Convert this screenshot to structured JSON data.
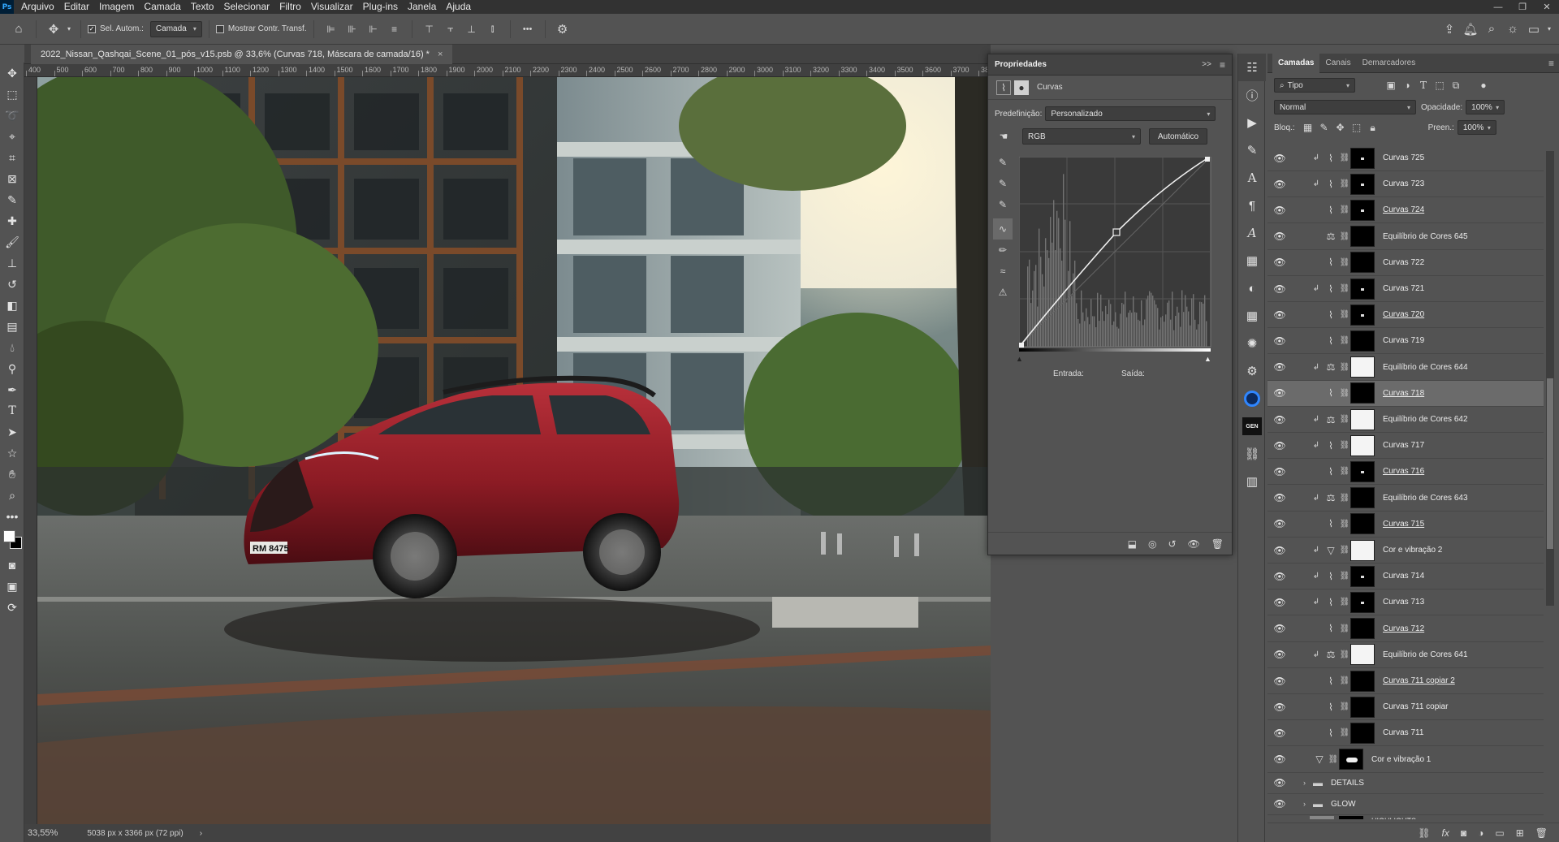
{
  "menubar": {
    "logo": "Ps",
    "items": [
      "Arquivo",
      "Editar",
      "Imagem",
      "Camada",
      "Texto",
      "Selecionar",
      "Filtro",
      "Visualizar",
      "Plug-ins",
      "Janela",
      "Ajuda"
    ],
    "win_min": "—",
    "win_max": "❐",
    "win_close": "✕"
  },
  "options": {
    "auto_select_label": "Sel. Autom.:",
    "auto_select_target": "Camada",
    "show_transform_label": "Mostrar Contr. Transf.",
    "more": "•••"
  },
  "document": {
    "tab_title": "2022_Nissan_Qashqai_Scene_01_pós_v15.psb @ 33,6% (Curvas 718, Máscara de camada/16) *",
    "tab_close": "×",
    "ruler_labels": [
      "400",
      "500",
      "600",
      "700",
      "800",
      "900",
      "1000",
      "1100",
      "1200",
      "1300",
      "1400",
      "1500",
      "1600",
      "1700",
      "1800",
      "1900",
      "2000",
      "2100",
      "2200",
      "2300",
      "2400",
      "2500",
      "2600",
      "2700",
      "2800",
      "2900",
      "3000",
      "3100",
      "3200",
      "3300",
      "3400",
      "3500",
      "3600",
      "3700",
      "38"
    ],
    "license_plate": "RM 8475",
    "zoom": "33,55%",
    "doc_size": "5038 px x 3366 px (72 ppi)",
    "status_arrow": "›"
  },
  "properties": {
    "title": "Propriedades",
    "collapse": ">>",
    "menu": "≡",
    "adjustment_label": "Curvas",
    "preset_label": "Predefinição:",
    "preset_value": "Personalizado",
    "channel_value": "RGB",
    "auto_button": "Automático",
    "input_label": "Entrada:",
    "output_label": "Saída:"
  },
  "layers": {
    "tabs": [
      "Camadas",
      "Canais",
      "Demarcadores"
    ],
    "filter_kind": "Tipo",
    "blend_mode": "Normal",
    "opacity_label": "Opacidade:",
    "opacity_value": "100%",
    "lock_label": "Bloq.:",
    "fill_label": "Preen.:",
    "fill_value": "100%",
    "rows": [
      {
        "name": "Curvas 725",
        "clip": true,
        "type": "curves",
        "mask": "dot",
        "underline": false,
        "selected": false
      },
      {
        "name": "Curvas 723",
        "clip": true,
        "type": "curves",
        "mask": "dot",
        "underline": false,
        "selected": false
      },
      {
        "name": "Curvas 724",
        "clip": false,
        "type": "curves",
        "mask": "dot",
        "underline": true,
        "selected": false
      },
      {
        "name": "Equilíbrio de Cores 645",
        "clip": false,
        "type": "balance",
        "mask": "black",
        "underline": false,
        "selected": false
      },
      {
        "name": "Curvas 722",
        "clip": false,
        "type": "curves",
        "mask": "black",
        "underline": false,
        "selected": false
      },
      {
        "name": "Curvas 721",
        "clip": true,
        "type": "curves",
        "mask": "dot",
        "underline": false,
        "selected": false
      },
      {
        "name": "Curvas 720",
        "clip": false,
        "type": "curves",
        "mask": "dot",
        "underline": true,
        "selected": false
      },
      {
        "name": "Curvas 719",
        "clip": false,
        "type": "curves",
        "mask": "black",
        "underline": false,
        "selected": false
      },
      {
        "name": "Equilíbrio de Cores 644",
        "clip": true,
        "type": "balance",
        "mask": "white",
        "underline": false,
        "selected": false
      },
      {
        "name": "Curvas 718",
        "clip": false,
        "type": "curves",
        "mask": "black",
        "underline": true,
        "selected": true
      },
      {
        "name": "Equilíbrio de Cores 642",
        "clip": true,
        "type": "balance",
        "mask": "white",
        "underline": false,
        "selected": false
      },
      {
        "name": "Curvas 717",
        "clip": true,
        "type": "curves",
        "mask": "white",
        "underline": false,
        "selected": false
      },
      {
        "name": "Curvas 716",
        "clip": false,
        "type": "curves",
        "mask": "dot",
        "underline": true,
        "selected": false
      },
      {
        "name": "Equilíbrio de Cores 643",
        "clip": true,
        "type": "balance",
        "mask": "black",
        "underline": false,
        "selected": false
      },
      {
        "name": "Curvas 715",
        "clip": false,
        "type": "curves",
        "mask": "black",
        "underline": true,
        "selected": false
      },
      {
        "name": "Cor e vibração 2",
        "clip": true,
        "type": "vibrance",
        "mask": "white",
        "underline": false,
        "selected": false
      },
      {
        "name": "Curvas 714",
        "clip": true,
        "type": "curves",
        "mask": "dot",
        "underline": false,
        "selected": false
      },
      {
        "name": "Curvas 713",
        "clip": true,
        "type": "curves",
        "mask": "dot",
        "underline": false,
        "selected": false
      },
      {
        "name": "Curvas 712",
        "clip": false,
        "type": "curves",
        "mask": "black",
        "underline": true,
        "selected": false
      },
      {
        "name": "Equilíbrio de Cores 641",
        "clip": true,
        "type": "balance",
        "mask": "white",
        "underline": false,
        "selected": false
      },
      {
        "name": "Curvas 711 copiar 2",
        "clip": false,
        "type": "curves",
        "mask": "black",
        "underline": true,
        "selected": false
      },
      {
        "name": "Curvas 711 copiar",
        "clip": false,
        "type": "curves",
        "mask": "black",
        "underline": false,
        "selected": false
      },
      {
        "name": "Curvas 711",
        "clip": false,
        "type": "curves",
        "mask": "black",
        "underline": false,
        "selected": false
      },
      {
        "name": "Cor e vibração 1",
        "clip": false,
        "type": "vibrance",
        "mask": "car",
        "underline": false,
        "selected": false
      }
    ],
    "groups": [
      "DETAILS",
      "GLOW"
    ],
    "partial_row": "HIGHLIGHTS"
  }
}
